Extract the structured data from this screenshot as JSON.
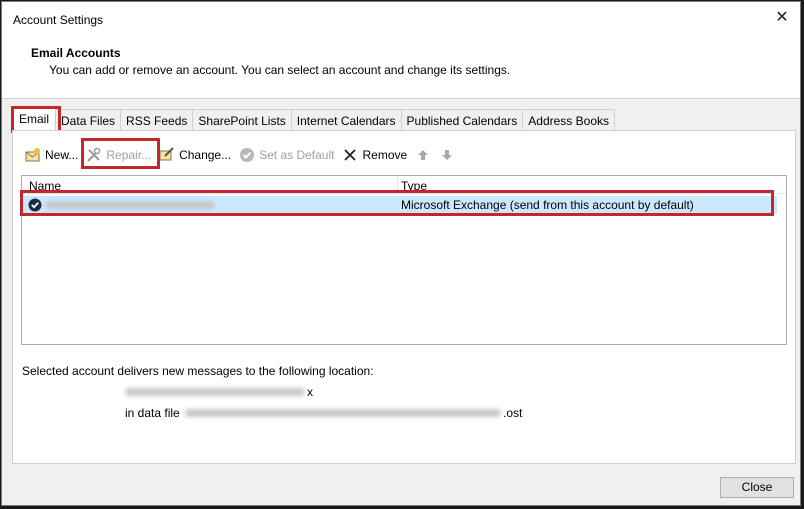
{
  "window": {
    "title": "Account Settings"
  },
  "header": {
    "title": "Email Accounts",
    "description": "You can add or remove an account. You can select an account and change its settings."
  },
  "tabs": [
    {
      "label": "Email",
      "active": true
    },
    {
      "label": "Data Files"
    },
    {
      "label": "RSS Feeds"
    },
    {
      "label": "SharePoint Lists"
    },
    {
      "label": "Internet Calendars"
    },
    {
      "label": "Published Calendars"
    },
    {
      "label": "Address Books"
    }
  ],
  "toolbar": {
    "new_label": "New...",
    "repair_label": "Repair...",
    "change_label": "Change...",
    "set_default_label": "Set as Default",
    "remove_label": "Remove"
  },
  "list": {
    "columns": {
      "name": "Name",
      "type": "Type"
    },
    "rows": [
      {
        "type": "Microsoft Exchange (send from this account by default)"
      }
    ]
  },
  "location": {
    "label": "Selected account delivers new messages to the following location:",
    "inbox_suffix": "x",
    "data_file_prefix": "in data file",
    "data_file_suffix": ".ost"
  },
  "footer": {
    "close_label": "Close"
  },
  "colors": {
    "highlight": "#c1272d",
    "selection": "#cce8ff"
  }
}
